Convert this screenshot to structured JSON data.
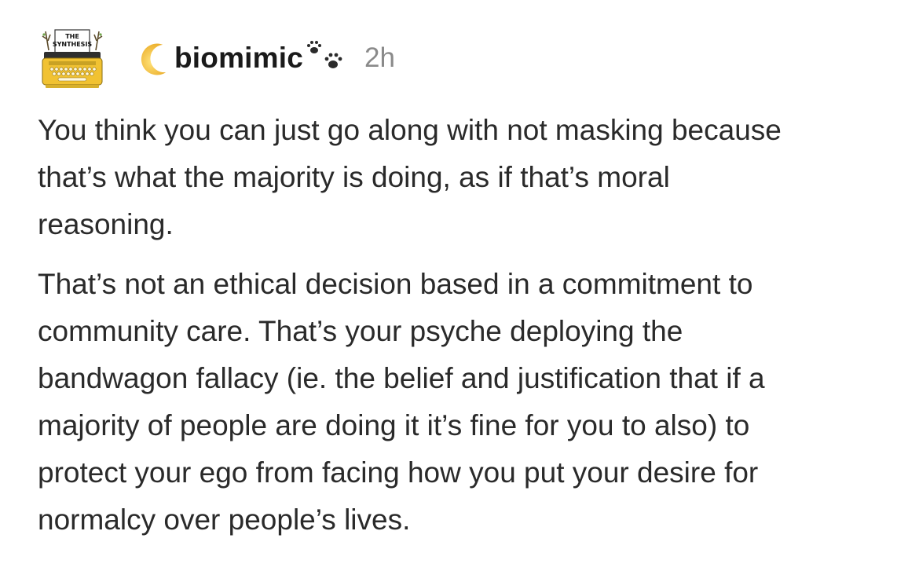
{
  "post": {
    "author": {
      "avatar_text_line1": "THE",
      "avatar_text_line2": "SYNTHESIS",
      "username": "biomimic",
      "moon_icon": "crescent-moon-icon",
      "paws_icon": "paw-prints-icon"
    },
    "timestamp": "2h",
    "paragraphs": [
      "You think you can just go along with not masking because\nthat’s what the majority is doing, as if that’s moral\nreasoning.",
      "That’s not an ethical decision based in a commitment to\ncommunity care. That’s your psyche deploying the\nbandwagon fallacy (ie. the belief and justification that if a\nmajority of people are doing it it’s fine for you to also) to\nprotect your ego from facing how you put your desire for\nnormalcy over people’s lives."
    ]
  },
  "colors": {
    "text": "#2a2a2a",
    "username": "#1a1a1a",
    "timestamp": "#8a8a8a",
    "moon": "#f6c342",
    "typewriter": "#f1c232"
  }
}
